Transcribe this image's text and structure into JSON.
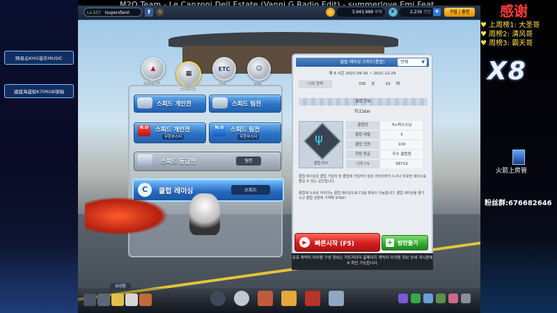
{
  "stream": {
    "title": "M2O Team - Le Canzoni Dell Estate (Vanni G Radio Edit) - summerlove      Emi Feat.",
    "left_buttons": [
      "网易云KHG音乐MUSIC",
      "键盘海盗船K70RGB银轴"
    ],
    "thanks": "感谢",
    "weekly": [
      "上周榜1: 大圣哥",
      "周榜2: 清风哥",
      "周榜3: 霸天哥"
    ],
    "logo": "X8",
    "fire_label": "火箭上房管",
    "fan_group": "粉丝群:676682646"
  },
  "topbar": {
    "level": "Lv.107",
    "username": "Isupersfarol",
    "coins": "3,943,988",
    "coin_unit": "루찌",
    "kcash": "2,239",
    "kcash_unit": "코인",
    "buy_label": "구입 | 충전"
  },
  "tabs": [
    {
      "icon": "rocket-icon",
      "label": "아이템 전"
    },
    {
      "icon": "checkered-flag-icon",
      "label": "스피드전"
    },
    {
      "icon": "etc-icon",
      "label": "기타"
    },
    {
      "icon": "char-icon",
      "label": "초보"
    }
  ],
  "menu": {
    "speed_solo": "스피드 개인전",
    "speed_team": "스피드 팀전",
    "speed_solo_nb": "스피드 개인전",
    "speed_solo_nb_sub": "무한부스터",
    "speed_team_nb": "스피드 팀전",
    "speed_team_nb_sub": "무한부스터",
    "ranked": "스피드 등급전",
    "ranked_sub": "팀전",
    "club": "클럽 레이싱",
    "club_sub": "스피드",
    "nbadge": "N.O"
  },
  "info": {
    "header": "클럽 레이싱 스피드(통합)",
    "dropdown": "전체",
    "season": "제 6 시즌  2021-09-30 ~ 2021-12-29",
    "record_label": "나의 전적",
    "record_wins": "336",
    "record_sep": "승",
    "record_losses": "61",
    "record_unit": "패",
    "club_info_title": "클럽 정보",
    "club_name": "TCCstar",
    "club_mark_label": "클럽 마크",
    "rows": [
      {
        "label": "클럽장",
        "value": "Tcc피스스님"
      },
      {
        "label": "클럽 레벨",
        "value": "5"
      },
      {
        "label": "클럽 인원",
        "value": "109"
      },
      {
        "label": "회원 등급",
        "value": "우수 클럽원"
      },
      {
        "label": "나의 CS",
        "value": "58719"
      }
    ],
    "desc1": "클럽 레이싱은 클럽 가입자 및 클럽에 가입하지 않은 라이더까지 누구나 자유한 레이스를 즐길 수 있는 공간입니다.",
    "desc2": "클럽에 소속된 라이더는 클럽 레이싱으로 CS를 획득이 가능합니다. 클럽 레이싱을 즐기시고 클럽 성장에 기여해 보세요!",
    "quick_start": "빠른시작 (F5)",
    "room_list": "방만들기",
    "notice": "유료 캐릭터 아이템 구성 정보는 카트라이더 홈페이지 캐릭터 아이템 정보 상세 게시판에서 확인 가능합니다."
  },
  "bottom_left_label": "보상함",
  "colors": {
    "accent_blue": "#2b72c4",
    "quick_red": "#d21c1c",
    "room_green": "#2fa82f"
  }
}
